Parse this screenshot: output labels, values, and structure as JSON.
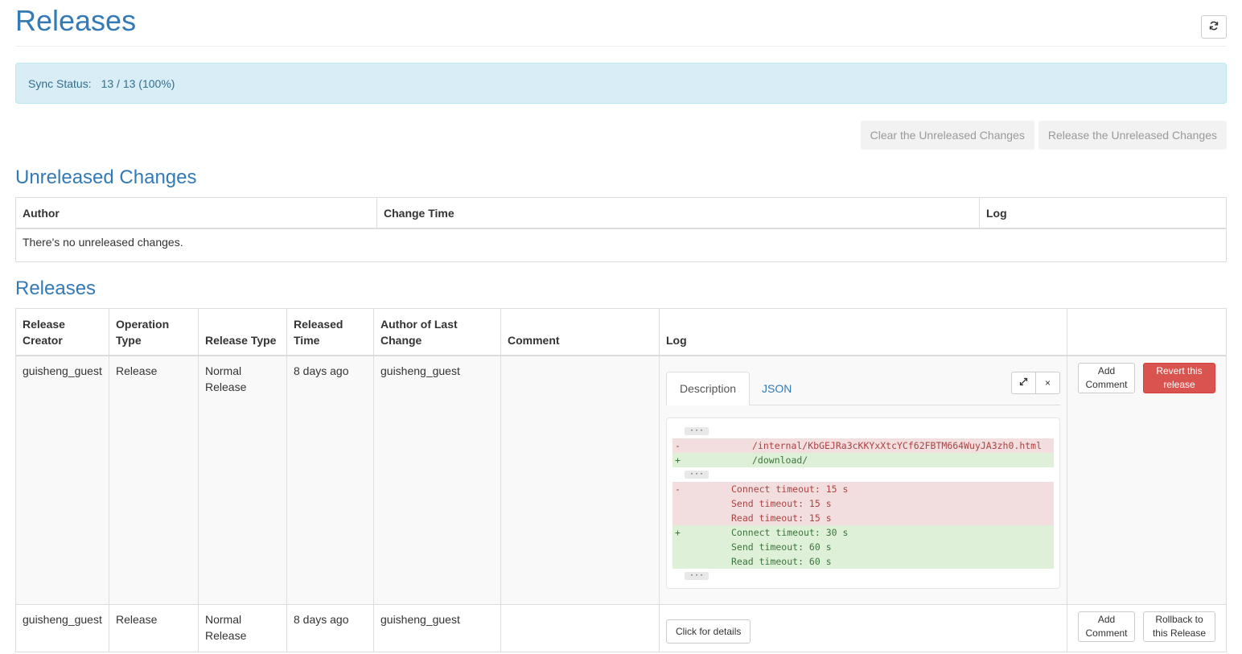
{
  "page": {
    "title": "Releases",
    "refresh_icon": "refresh-icon"
  },
  "sync": {
    "label": "Sync Status:",
    "value": "13 / 13 (100%)"
  },
  "unreleased_actions": {
    "clear_label": "Clear the Unreleased Changes",
    "release_label": "Release the Unreleased Changes"
  },
  "unreleased": {
    "title": "Unreleased Changes",
    "columns": [
      "Author",
      "Change Time",
      "Log"
    ],
    "empty_message": "There's no unreleased changes."
  },
  "releases": {
    "title": "Releases",
    "columns": [
      "Release Creator",
      "Operation Type",
      "Release Type",
      "Released Time",
      "Author of Last Change",
      "Comment",
      "Log",
      ""
    ],
    "rows": [
      {
        "creator": "guisheng_guest",
        "operation": "Release",
        "release_type": "Normal Release",
        "time": "8 days ago",
        "author": "guisheng_guest",
        "comment": "",
        "log": {
          "tab_description": "Description",
          "tab_json": "JSON",
          "expand_icon": "expand-icon",
          "close_label": "×",
          "ellipsis": "···",
          "diff": [
            {
              "marker": "-",
              "text": "/internal/KbGEJRa3cKKYxXtcYCf62FBTM664WuyJA3zh0.html"
            },
            {
              "marker": "+",
              "text": "/download/"
            },
            {
              "marker": "-",
              "text": "Connect timeout: 15 s"
            },
            {
              "marker": "",
              "text": "Send timeout: 15 s"
            },
            {
              "marker": "",
              "text": "Read timeout: 15 s"
            },
            {
              "marker": "+",
              "text": "Connect timeout: 30 s"
            },
            {
              "marker": "",
              "text": "Send timeout: 60 s"
            },
            {
              "marker": "",
              "text": "Read timeout: 60 s"
            }
          ]
        },
        "add_comment": "Add Comment",
        "action": "Revert this release"
      },
      {
        "creator": "guisheng_guest",
        "operation": "Release",
        "release_type": "Normal Release",
        "time": "8 days ago",
        "author": "guisheng_guest",
        "comment": "",
        "details_label": "Click for details",
        "add_comment": "Add Comment",
        "action": "Rollback to this Release"
      }
    ]
  },
  "colors": {
    "accent": "#337ab7",
    "alert_bg": "#d9edf7",
    "danger": "#d9534f",
    "diff_del": "#f2dede",
    "diff_add": "#dff0d8"
  }
}
